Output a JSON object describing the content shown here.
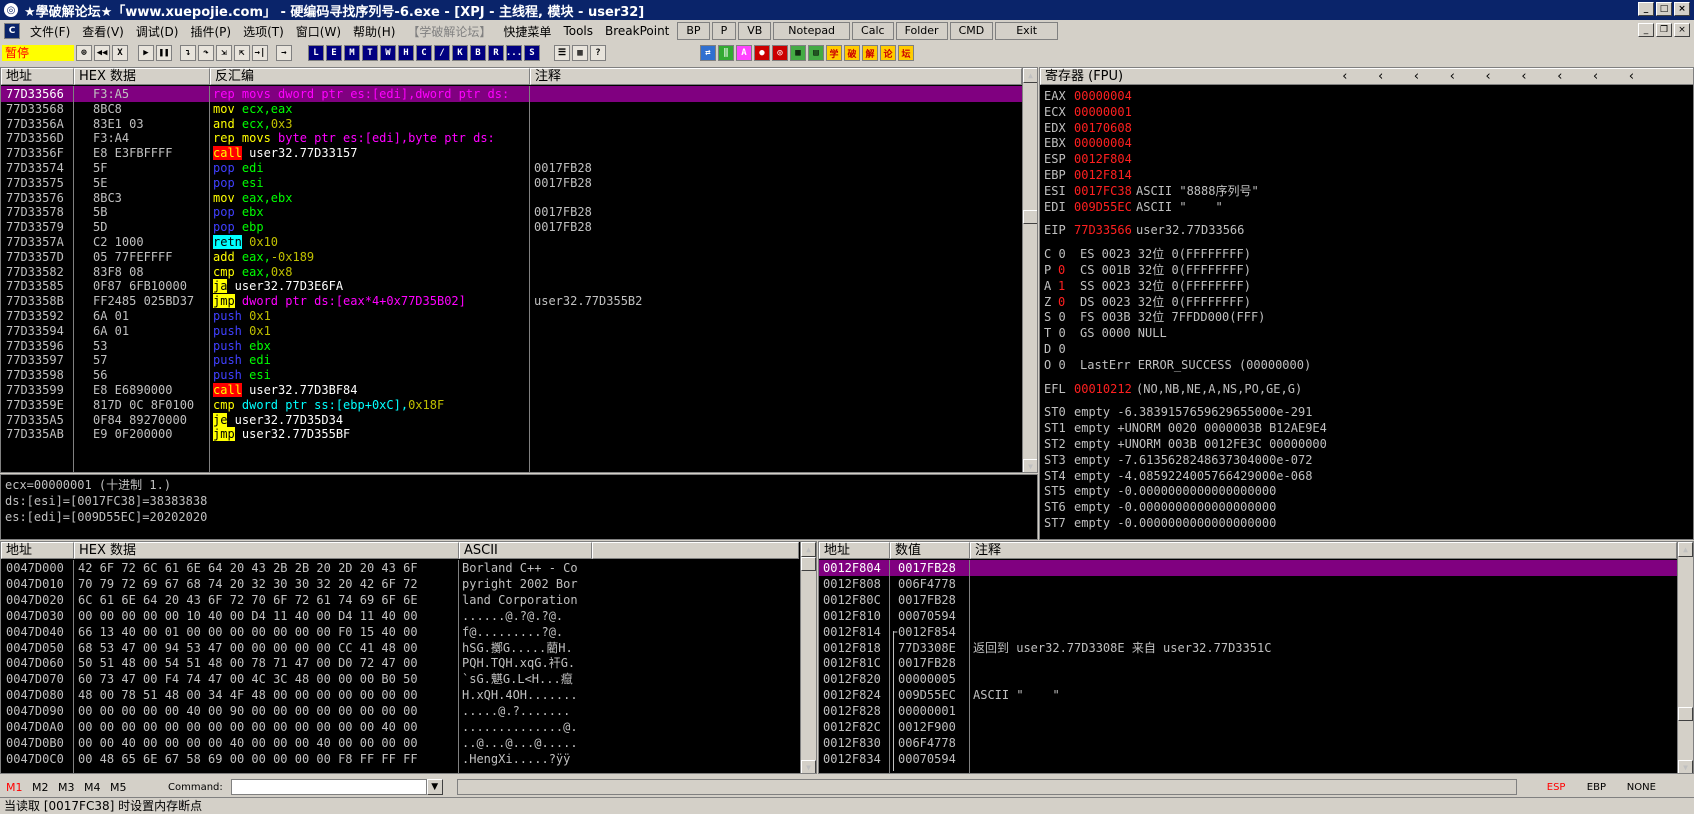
{
  "title": "★學破解论坛★「www.xuepojie.com」 - 硬编码寻找序列号-6.exe - [XPJ - 主线程, 模块 - user32]",
  "menu": [
    "文件(F)",
    "查看(V)",
    "调试(D)",
    "插件(P)",
    "选项(T)",
    "窗口(W)",
    "帮助(H)"
  ],
  "menu_disabled": "【学破解论坛】",
  "menu_extra": [
    "快捷菜单",
    "Tools",
    "BreakPoint"
  ],
  "menu_buttons": [
    "BP",
    "P",
    "VB",
    "Notepad",
    "Calc",
    "Folder",
    "CMD",
    "Exit"
  ],
  "toolbar": {
    "status": "暂停",
    "letters": [
      "L",
      "E",
      "M",
      "T",
      "W",
      "H",
      "C",
      "/",
      "K",
      "B",
      "R",
      "...",
      "S"
    ],
    "right": [
      "学",
      "破",
      "解",
      "论",
      "坛"
    ]
  },
  "cpu_headers": {
    "addr": "地址",
    "hex": "HEX 数据",
    "disasm": "反汇编",
    "comment": "注释"
  },
  "cpu_rows": [
    {
      "addr": "77D33566",
      "hex": "F3:A5",
      "tokens": [
        [
          "rep movs ",
          "#ff00ff",
          ""
        ],
        [
          "dword ptr es:[edi],dword ptr ds:",
          "#ff00ff",
          ""
        ]
      ],
      "comment": "",
      "sel": true
    },
    {
      "addr": "77D33568",
      "hex": "8BC8",
      "tokens": [
        [
          "mov ",
          "#ffff00",
          ""
        ],
        [
          "ecx,eax",
          "#00ff00",
          ""
        ]
      ],
      "comment": ""
    },
    {
      "addr": "77D3356A",
      "hex": "83E1 03",
      "tokens": [
        [
          "and ",
          "#ffff00",
          ""
        ],
        [
          "ecx,",
          "#00ff00",
          ""
        ],
        [
          "0x3",
          "#c0c000",
          ""
        ]
      ],
      "comment": ""
    },
    {
      "addr": "77D3356D",
      "hex": "F3:A4",
      "tokens": [
        [
          "rep movs ",
          "#ffff00",
          ""
        ],
        [
          "byte ptr es:[edi],byte ptr ds:",
          "#ff00ff",
          ""
        ]
      ],
      "comment": ""
    },
    {
      "addr": "77D3356F",
      "hex": "E8 E3FBFFFF",
      "tokens": [
        [
          "call",
          "#ffff00",
          "#ff0000"
        ],
        [
          " user32.77D33157",
          "#ffffff",
          ""
        ]
      ],
      "comment": ""
    },
    {
      "addr": "77D33574",
      "hex": "5F",
      "tokens": [
        [
          "pop ",
          "#4040ff",
          ""
        ],
        [
          "edi",
          "#00ff00",
          ""
        ]
      ],
      "comment": "0017FB28"
    },
    {
      "addr": "77D33575",
      "hex": "5E",
      "tokens": [
        [
          "pop ",
          "#4040ff",
          ""
        ],
        [
          "esi",
          "#00ff00",
          ""
        ]
      ],
      "comment": "0017FB28"
    },
    {
      "addr": "77D33576",
      "hex": "8BC3",
      "tokens": [
        [
          "mov ",
          "#ffff00",
          ""
        ],
        [
          "eax,ebx",
          "#00ff00",
          ""
        ]
      ],
      "comment": ""
    },
    {
      "addr": "77D33578",
      "hex": "5B",
      "tokens": [
        [
          "pop ",
          "#4040ff",
          ""
        ],
        [
          "ebx",
          "#00ff00",
          ""
        ]
      ],
      "comment": "0017FB28"
    },
    {
      "addr": "77D33579",
      "hex": "5D",
      "tokens": [
        [
          "pop ",
          "#4040ff",
          ""
        ],
        [
          "ebp",
          "#00ff00",
          ""
        ]
      ],
      "comment": "0017FB28"
    },
    {
      "addr": "77D3357A",
      "hex": "C2 1000",
      "tokens": [
        [
          "retn",
          "#000000",
          "#00ffff"
        ],
        [
          " 0x10",
          "#c0c000",
          ""
        ]
      ],
      "comment": ""
    },
    {
      "addr": "77D3357D",
      "hex": "05 77FEFFFF",
      "tokens": [
        [
          "add ",
          "#ffff00",
          ""
        ],
        [
          "eax,",
          "#00ff00",
          ""
        ],
        [
          "-0x189",
          "#c0c000",
          ""
        ]
      ],
      "comment": ""
    },
    {
      "addr": "77D33582",
      "hex": "83F8 08",
      "tokens": [
        [
          "cmp ",
          "#ffff00",
          ""
        ],
        [
          "eax,",
          "#00ff00",
          ""
        ],
        [
          "0x8",
          "#c0c000",
          ""
        ]
      ],
      "comment": ""
    },
    {
      "addr": "77D33585",
      "hex": "0F87 6FB10000",
      "tokens": [
        [
          "ja",
          "#000000",
          "#ffff00"
        ],
        [
          " user32.77D3E6FA",
          "#ffffff",
          ""
        ]
      ],
      "comment": ""
    },
    {
      "addr": "77D3358B",
      "hex": "FF2485 025BD37",
      "tokens": [
        [
          "jmp",
          "#000000",
          "#ffff00"
        ],
        [
          " dword ptr ds:[eax*4+0x77D35B02]",
          "#ff00ff",
          ""
        ]
      ],
      "comment": "user32.77D355B2"
    },
    {
      "addr": "77D33592",
      "hex": "6A 01",
      "tokens": [
        [
          "push ",
          "#4040ff",
          ""
        ],
        [
          "0x1",
          "#c0c000",
          ""
        ]
      ],
      "comment": ""
    },
    {
      "addr": "77D33594",
      "hex": "6A 01",
      "tokens": [
        [
          "push ",
          "#4040ff",
          ""
        ],
        [
          "0x1",
          "#c0c000",
          ""
        ]
      ],
      "comment": ""
    },
    {
      "addr": "77D33596",
      "hex": "53",
      "tokens": [
        [
          "push ",
          "#4040ff",
          ""
        ],
        [
          "ebx",
          "#00ff00",
          ""
        ]
      ],
      "comment": ""
    },
    {
      "addr": "77D33597",
      "hex": "57",
      "tokens": [
        [
          "push ",
          "#4040ff",
          ""
        ],
        [
          "edi",
          "#00ff00",
          ""
        ]
      ],
      "comment": ""
    },
    {
      "addr": "77D33598",
      "hex": "56",
      "tokens": [
        [
          "push ",
          "#4040ff",
          ""
        ],
        [
          "esi",
          "#00ff00",
          ""
        ]
      ],
      "comment": ""
    },
    {
      "addr": "77D33599",
      "hex": "E8 E6890000",
      "tokens": [
        [
          "call",
          "#ffff00",
          "#ff0000"
        ],
        [
          " user32.77D3BF84",
          "#ffffff",
          ""
        ]
      ],
      "comment": ""
    },
    {
      "addr": "77D3359E",
      "hex": "817D 0C 8F0100",
      "tokens": [
        [
          "cmp ",
          "#ffff00",
          ""
        ],
        [
          "dword ptr ss:[ebp+0xC],",
          "#00ffff",
          ""
        ],
        [
          "0x18F",
          "#c0c000",
          ""
        ]
      ],
      "comment": ""
    },
    {
      "addr": "77D335A5",
      "hex": "0F84 89270000",
      "tokens": [
        [
          "je",
          "#000000",
          "#ffff00"
        ],
        [
          " user32.77D35D34",
          "#ffffff",
          ""
        ]
      ],
      "comment": ""
    },
    {
      "addr": "77D335AB",
      "hex": "E9 0F200000",
      "tokens": [
        [
          "jmp",
          "#000000",
          "#ffff00"
        ],
        [
          " user32.77D355BF",
          "#ffffff",
          ""
        ]
      ],
      "comment": ""
    }
  ],
  "info_lines": [
    "ecx=00000001 (十进制 1.)",
    "ds:[esi]=[0017FC38]=38383838",
    "es:[edi]=[009D55EC]=20202020"
  ],
  "reg_header": "寄存器 (FPU)",
  "registers": [
    {
      "n": "EAX",
      "v": "00000004",
      "c": ""
    },
    {
      "n": "ECX",
      "v": "00000001",
      "c": ""
    },
    {
      "n": "EDX",
      "v": "00170608",
      "c": ""
    },
    {
      "n": "EBX",
      "v": "00000004",
      "c": ""
    },
    {
      "n": "ESP",
      "v": "0012F804",
      "c": ""
    },
    {
      "n": "EBP",
      "v": "0012F814",
      "c": ""
    },
    {
      "n": "ESI",
      "v": "0017FC38",
      "c": "ASCII \"8888序列号\""
    },
    {
      "n": "EDI",
      "v": "009D55EC",
      "c": "ASCII \"    \""
    },
    {
      "n": "",
      "v": "",
      "c": ""
    },
    {
      "n": "EIP",
      "v": "77D33566",
      "c": "user32.77D33566"
    },
    {
      "n": "",
      "v": "",
      "c": ""
    },
    {
      "n": "C 0",
      "v": "",
      "c": "ES 0023 32位 0(FFFFFFFF)"
    },
    {
      "n": "P",
      "v": "0",
      "c": "CS 001B 32位 0(FFFFFFFF)"
    },
    {
      "n": "A",
      "v": "1",
      "c": "SS 0023 32位 0(FFFFFFFF)"
    },
    {
      "n": "Z",
      "v": "0",
      "c": "DS 0023 32位 0(FFFFFFFF)"
    },
    {
      "n": "S 0",
      "v": "",
      "c": "FS 003B 32位 7FFDD000(FFF)"
    },
    {
      "n": "T 0",
      "v": "",
      "c": "GS 0000 NULL"
    },
    {
      "n": "D 0",
      "v": "",
      "c": ""
    },
    {
      "n": "O 0",
      "v": "",
      "c": "LastErr ERROR_SUCCESS (00000000)"
    },
    {
      "n": "",
      "v": "",
      "c": ""
    },
    {
      "n": "EFL",
      "v": "00010212",
      "c": "(NO,NB,NE,A,NS,PO,GE,G)"
    },
    {
      "n": "",
      "v": "",
      "c": ""
    },
    {
      "n": "ST0",
      "v": "",
      "c": "empty -6.3839157659629655000e-291"
    },
    {
      "n": "ST1",
      "v": "",
      "c": "empty +UNORM 0020 0000003B B12AE9E4"
    },
    {
      "n": "ST2",
      "v": "",
      "c": "empty +UNORM 003B 0012FE3C 00000000"
    },
    {
      "n": "ST3",
      "v": "",
      "c": "empty -7.6135628248637304000e-072"
    },
    {
      "n": "ST4",
      "v": "",
      "c": "empty -4.0859224005766429000e-068"
    },
    {
      "n": "ST5",
      "v": "",
      "c": "empty -0.0000000000000000000"
    },
    {
      "n": "ST6",
      "v": "",
      "c": "empty -0.0000000000000000000"
    },
    {
      "n": "ST7",
      "v": "",
      "c": "empty -0.0000000000000000000"
    }
  ],
  "dump_headers": {
    "addr": "地址",
    "hex": "HEX 数据",
    "ascii": "ASCII"
  },
  "dump_rows": [
    {
      "addr": "0047D000",
      "hex": "42 6F 72 6C 61 6E 64 20 43 2B 2B 20 2D 20 43 6F",
      "ascii": "Borland C++ - Co"
    },
    {
      "addr": "0047D010",
      "hex": "70 79 72 69 67 68 74 20 32 30 30 32 20 42 6F 72",
      "ascii": "pyright 2002 Bor"
    },
    {
      "addr": "0047D020",
      "hex": "6C 61 6E 64 20 43 6F 72 70 6F 72 61 74 69 6F 6E",
      "ascii": "land Corporation"
    },
    {
      "addr": "0047D030",
      "hex": "00 00 00 00 00 10 40 00 D4 11 40 00 D4 11 40 00",
      "ascii": "......@.?@.?@."
    },
    {
      "addr": "0047D040",
      "hex": "66 13 40 00 01 00 00 00 00 00 00 00 F0 15 40 00",
      "ascii": "f@.........?@."
    },
    {
      "addr": "0047D050",
      "hex": "68 53 47 00 94 53 47 00 00 00 00 00 CC 41 48 00",
      "ascii": "hSG.擲G.....藺H."
    },
    {
      "addr": "0047D060",
      "hex": "50 51 48 00 54 51 48 00 78 71 47 00 D0 72 47 00",
      "ascii": "PQH.TQH.xqG.衦G."
    },
    {
      "addr": "0047D070",
      "hex": "60 73 47 00 F4 74 47 00 4C 3C 48 00 00 00 B0 50",
      "ascii": "`sG.魌G.L<H...癙"
    },
    {
      "addr": "0047D080",
      "hex": "48 00 78 51 48 00 34 4F 48 00 00 00 00 00 00 00",
      "ascii": "H.xQH.4OH......."
    },
    {
      "addr": "0047D090",
      "hex": "00 00 00 00 00 40 00 90 00 00 00 00 00 00 00 00",
      "ascii": ".....@.?......."
    },
    {
      "addr": "0047D0A0",
      "hex": "00 00 00 00 00 00 00 00 00 00 00 00 00 00 40 00",
      "ascii": "..............@."
    },
    {
      "addr": "0047D0B0",
      "hex": "00 00 40 00 00 00 00 40 00 00 00 40 00 00 00 00",
      "ascii": "..@...@...@....."
    },
    {
      "addr": "0047D0C0",
      "hex": "00 48 65 6E 67 58 69 00 00 00 00 00 F8 FF FF FF",
      "ascii": ".HengXi.....?ÿÿ"
    }
  ],
  "stack_headers": {
    "addr": "地址",
    "val": "数值",
    "comment": "注释"
  },
  "stack_rows": [
    {
      "addr": "0012F804",
      "val": "0017FB28",
      "comment": "",
      "sel": true
    },
    {
      "addr": "0012F808",
      "val": "006F4778",
      "comment": ""
    },
    {
      "addr": "0012F80C",
      "val": "0017FB28",
      "comment": ""
    },
    {
      "addr": "0012F810",
      "val": "00070594",
      "comment": ""
    },
    {
      "addr": "0012F814",
      "val": "0012F854",
      "comment": "",
      "bracket": true
    },
    {
      "addr": "0012F818",
      "val": "77D3308E",
      "comment": "返回到 user32.77D3308E 来自 user32.77D3351C"
    },
    {
      "addr": "0012F81C",
      "val": "0017FB28",
      "comment": ""
    },
    {
      "addr": "0012F820",
      "val": "00000005",
      "comment": ""
    },
    {
      "addr": "0012F824",
      "val": "009D55EC",
      "comment": "ASCII \"    \""
    },
    {
      "addr": "0012F828",
      "val": "00000001",
      "comment": ""
    },
    {
      "addr": "0012F82C",
      "val": "0012F900",
      "comment": ""
    },
    {
      "addr": "0012F830",
      "val": "006F4778",
      "comment": ""
    },
    {
      "addr": "0012F834",
      "val": "00070594",
      "comment": ""
    }
  ],
  "bottom": {
    "tabs": [
      "M1",
      "M2",
      "M3",
      "M4",
      "M5"
    ],
    "command_label": "Command:",
    "command_value": "",
    "right": [
      "ESP",
      "EBP",
      "NONE"
    ]
  },
  "status_line": "当读取 [0017FC38] 时设置内存断点"
}
